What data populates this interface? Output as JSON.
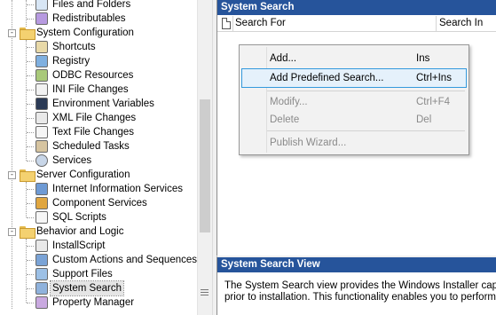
{
  "tree": {
    "items": [
      {
        "label": "Files and Folders",
        "icon": "folder-icon"
      },
      {
        "label": "Redistributables",
        "icon": "redistributables-icon"
      },
      {
        "label": "System Configuration",
        "icon": "folder-icon",
        "expander": "-"
      },
      {
        "label": "Shortcuts",
        "icon": "shortcuts-icon"
      },
      {
        "label": "Registry",
        "icon": "registry-icon"
      },
      {
        "label": "ODBC Resources",
        "icon": "odbc-icon"
      },
      {
        "label": "INI File Changes",
        "icon": "ini-file-icon"
      },
      {
        "label": "Environment Variables",
        "icon": "environment-variables-icon"
      },
      {
        "label": "XML File Changes",
        "icon": "xml-file-icon"
      },
      {
        "label": "Text File Changes",
        "icon": "text-file-icon"
      },
      {
        "label": "Scheduled Tasks",
        "icon": "scheduled-tasks-icon"
      },
      {
        "label": "Services",
        "icon": "services-icon"
      },
      {
        "label": "Server Configuration",
        "icon": "folder-icon",
        "expander": "-"
      },
      {
        "label": "Internet Information Services",
        "icon": "iis-icon"
      },
      {
        "label": "Component Services",
        "icon": "component-services-icon"
      },
      {
        "label": "SQL Scripts",
        "icon": "sql-icon"
      },
      {
        "label": "Behavior and Logic",
        "icon": "folder-icon",
        "expander": "-"
      },
      {
        "label": "InstallScript",
        "icon": "installscript-icon"
      },
      {
        "label": "Custom Actions and Sequences",
        "icon": "custom-actions-icon"
      },
      {
        "label": "Support Files",
        "icon": "support-files-icon"
      },
      {
        "label": "System Search",
        "icon": "system-search-icon",
        "selected": true
      },
      {
        "label": "Property Manager",
        "icon": "property-manager-icon"
      }
    ]
  },
  "search_panel": {
    "title": "System Search",
    "columns": [
      "Search For",
      "Search In"
    ]
  },
  "context_menu": {
    "items": [
      {
        "label": "Add...",
        "shortcut": "Ins",
        "disabled": false
      },
      {
        "label": "Add Predefined Search...",
        "shortcut": "Ctrl+Ins",
        "disabled": false,
        "highlighted": true
      },
      {
        "label": "Modify...",
        "shortcut": "Ctrl+F4",
        "disabled": true
      },
      {
        "label": "Delete",
        "shortcut": "Del",
        "disabled": true
      },
      {
        "label": "Publish Wizard...",
        "shortcut": "",
        "disabled": true
      }
    ]
  },
  "help_panel": {
    "title": "System Search View",
    "line1": "The System Search view provides the Windows Installer capabi",
    "line2": "prior to installation. This functionality enables you to perform ap"
  },
  "colors": {
    "title_bar": "#26549b",
    "menu_highlight": "#e5f1fb",
    "menu_highlight_border": "#3399dd",
    "folder": "#f4d170"
  }
}
